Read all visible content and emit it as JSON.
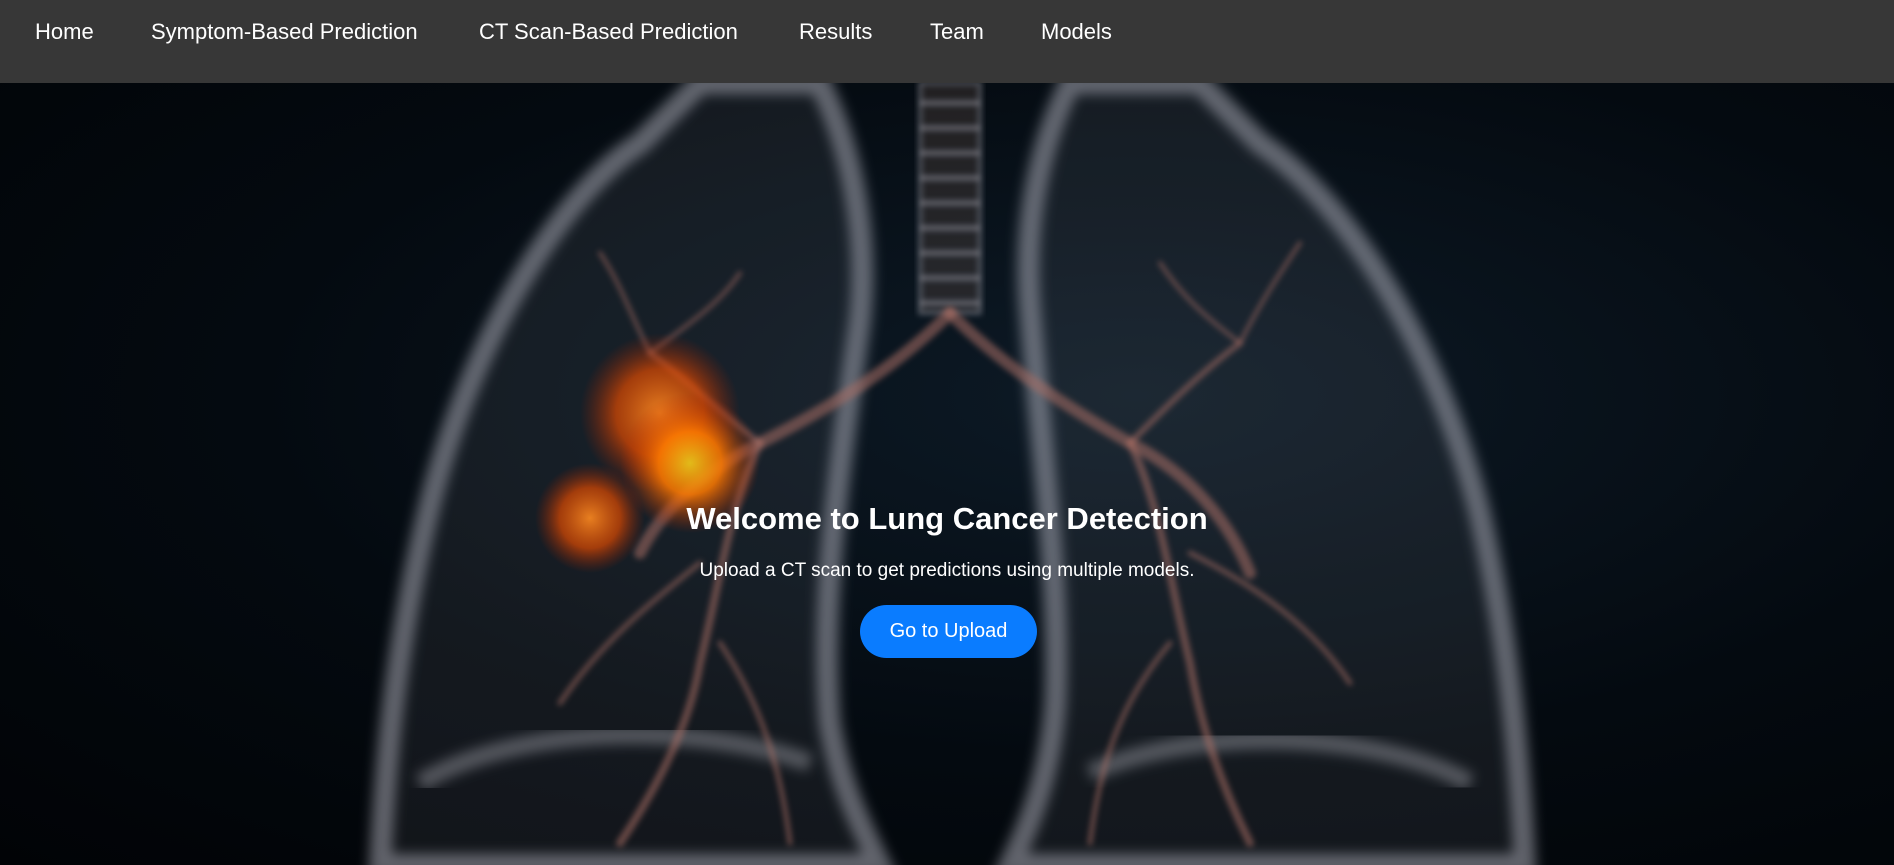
{
  "nav": {
    "items": [
      {
        "label": "Home"
      },
      {
        "label": "Symptom-Based Prediction"
      },
      {
        "label": "CT Scan-Based Prediction"
      },
      {
        "label": "Results"
      },
      {
        "label": "Team"
      },
      {
        "label": "Models"
      }
    ]
  },
  "hero": {
    "title": "Welcome to Lung Cancer Detection",
    "subtitle": "Upload a CT scan to get predictions using multiple models.",
    "button_label": "Go to Upload",
    "image": "lung-tumor-illustration"
  },
  "colors": {
    "navbar_bg": "#373737",
    "button_bg": "#0a7cff",
    "tumor_glow": "#ff6a00"
  }
}
